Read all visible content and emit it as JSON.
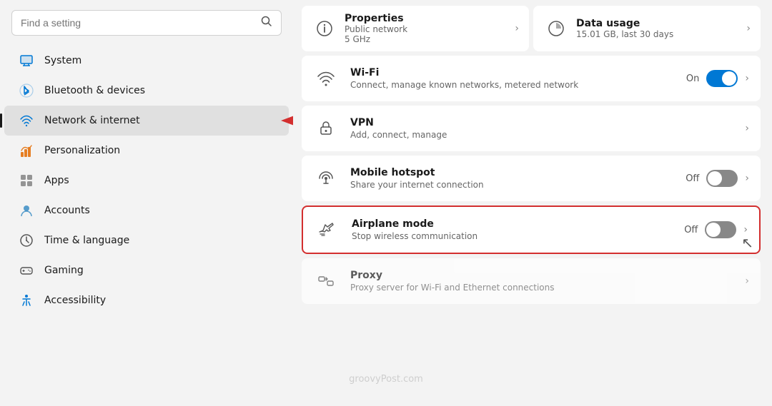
{
  "sidebar": {
    "search_placeholder": "Find a setting",
    "items": [
      {
        "id": "system",
        "label": "System",
        "icon": "monitor"
      },
      {
        "id": "bluetooth",
        "label": "Bluetooth & devices",
        "icon": "bluetooth"
      },
      {
        "id": "network",
        "label": "Network & internet",
        "icon": "network",
        "active": true
      },
      {
        "id": "personalization",
        "label": "Personalization",
        "icon": "personalization"
      },
      {
        "id": "apps",
        "label": "Apps",
        "icon": "apps"
      },
      {
        "id": "accounts",
        "label": "Accounts",
        "icon": "accounts"
      },
      {
        "id": "time",
        "label": "Time & language",
        "icon": "time"
      },
      {
        "id": "gaming",
        "label": "Gaming",
        "icon": "gaming"
      },
      {
        "id": "accessibility",
        "label": "Accessibility",
        "icon": "accessibility"
      }
    ]
  },
  "main": {
    "top_cards": [
      {
        "id": "properties",
        "title": "Properties",
        "subtitle_lines": [
          "Public network",
          "5 GHz"
        ],
        "icon": "info",
        "has_chevron": true
      },
      {
        "id": "data_usage",
        "title": "Data usage",
        "subtitle": "15.01 GB, last 30 days",
        "icon": "chart",
        "has_chevron": true
      }
    ],
    "settings_rows": [
      {
        "id": "wifi",
        "title": "Wi-Fi",
        "subtitle": "Connect, manage known networks, metered network",
        "icon": "wifi",
        "control_type": "toggle",
        "control_label": "On",
        "toggle_state": "on",
        "has_chevron": true
      },
      {
        "id": "vpn",
        "title": "VPN",
        "subtitle": "Add, connect, manage",
        "icon": "vpn",
        "control_type": "chevron",
        "has_chevron": true
      },
      {
        "id": "hotspot",
        "title": "Mobile hotspot",
        "subtitle": "Share your internet connection",
        "icon": "hotspot",
        "control_type": "toggle",
        "control_label": "Off",
        "toggle_state": "off",
        "has_chevron": true
      },
      {
        "id": "airplane",
        "title": "Airplane mode",
        "subtitle": "Stop wireless communication",
        "icon": "airplane",
        "control_type": "toggle",
        "control_label": "Off",
        "toggle_state": "off",
        "has_chevron": true,
        "highlighted": true
      }
    ],
    "proxy_row": {
      "title": "Proxy",
      "subtitle": "Proxy server for Wi-Fi and Ethernet connections",
      "icon": "proxy",
      "has_chevron": true
    }
  }
}
